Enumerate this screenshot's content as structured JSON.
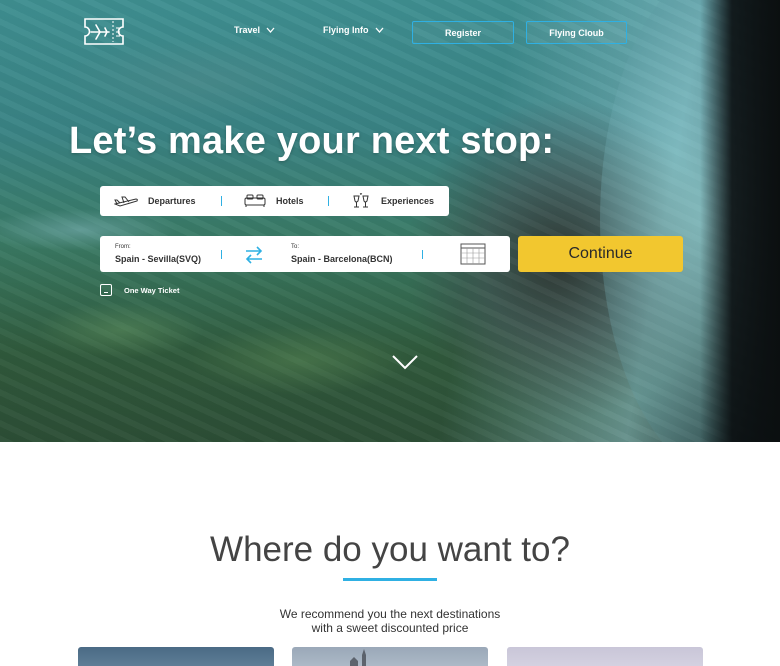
{
  "nav": {
    "logo_icon": "ticket-plane-icon",
    "items": [
      {
        "label": "Travel",
        "icon": "chevron-down-icon"
      },
      {
        "label": "Flying Info",
        "icon": "chevron-down-icon"
      }
    ],
    "buttons": [
      {
        "label": "Register"
      },
      {
        "label": "Flying Cloub"
      }
    ]
  },
  "hero": {
    "headline": "Let’s make your next stop:",
    "tabs": [
      {
        "label": "Departures",
        "icon": "airplane-icon"
      },
      {
        "label": "Hotels",
        "icon": "bed-icon"
      },
      {
        "label": "Experiences",
        "icon": "glasses-toast-icon"
      }
    ],
    "search": {
      "from_label": "From:",
      "from_value": "Spain - Sevilla(SVQ)",
      "to_label": "To:",
      "to_value": "Spain - Barcelona(BCN)",
      "swap_icon": "swap-arrows-icon",
      "calendar_icon": "calendar-icon"
    },
    "continue_label": "Continue",
    "one_way_label": "One Way Ticket",
    "scroll_icon": "chevron-down-icon"
  },
  "destinations": {
    "title": "Where do you want to?",
    "subtitle_line1": "We recommend you the next destinations",
    "subtitle_line2": "with a sweet discounted price"
  },
  "colors": {
    "accent": "#2fb0e3",
    "cta": "#f2c72f",
    "text_dark": "#444444"
  }
}
